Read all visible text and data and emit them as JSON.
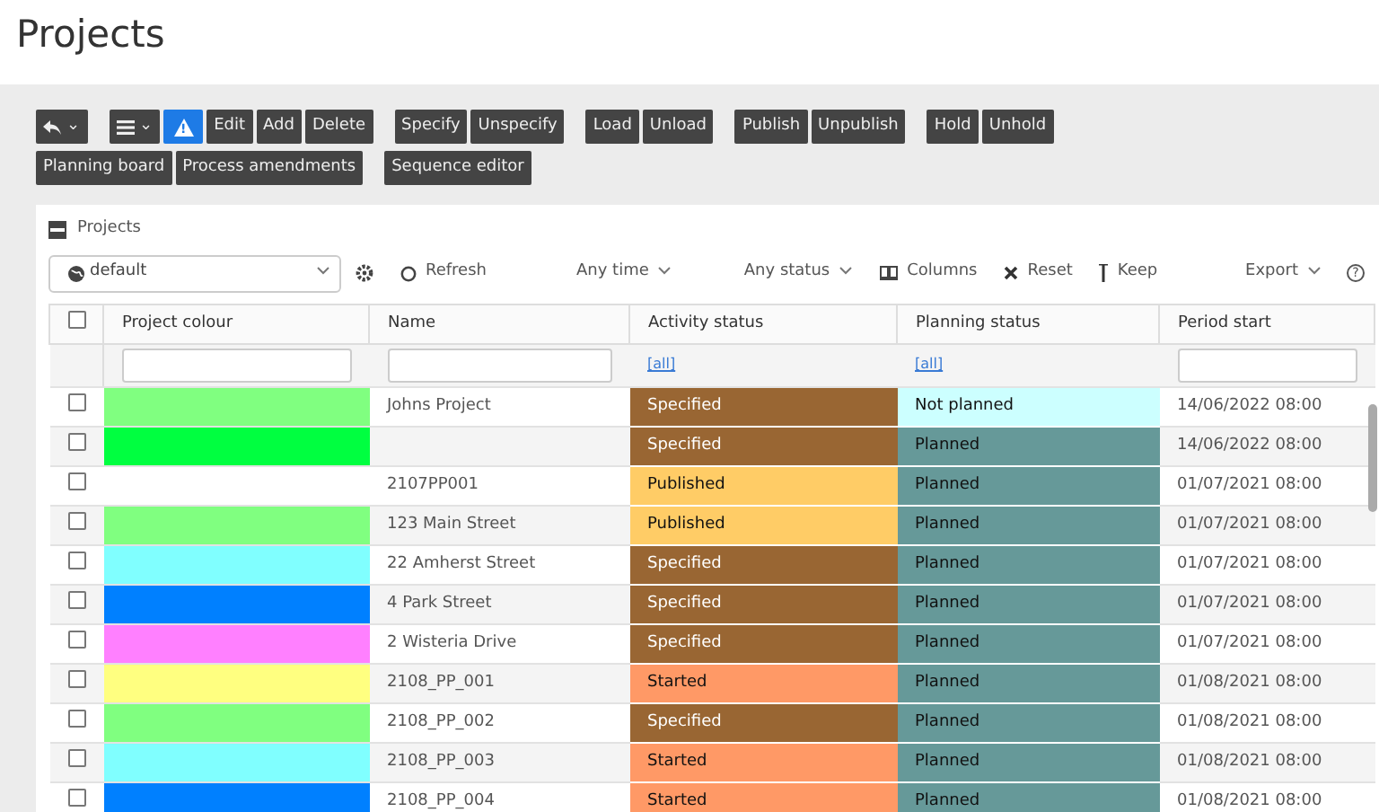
{
  "page_title": "Projects",
  "toolbar": [
    {
      "buttons": [
        {
          "kind": "undo-dropdown",
          "label": "⌄"
        }
      ]
    },
    {
      "buttons": [
        {
          "kind": "menu-dropdown",
          "label": "⌄"
        },
        {
          "kind": "warning",
          "label": "!"
        },
        {
          "kind": "text",
          "label": "Edit"
        },
        {
          "kind": "text",
          "label": "Add"
        },
        {
          "kind": "text",
          "label": "Delete"
        }
      ]
    },
    {
      "buttons": [
        {
          "kind": "text",
          "label": "Specify"
        },
        {
          "kind": "text",
          "label": "Unspecify"
        }
      ]
    },
    {
      "buttons": [
        {
          "kind": "text",
          "label": "Load"
        },
        {
          "kind": "text",
          "label": "Unload"
        }
      ]
    },
    {
      "buttons": [
        {
          "kind": "text",
          "label": "Publish"
        },
        {
          "kind": "text",
          "label": "Unpublish"
        }
      ]
    },
    {
      "buttons": [
        {
          "kind": "text",
          "label": "Hold"
        },
        {
          "kind": "text",
          "label": "Unhold"
        }
      ]
    },
    {
      "buttons": [
        {
          "kind": "text",
          "label": "Planning board"
        },
        {
          "kind": "text",
          "label": "Process amendments"
        }
      ]
    },
    {
      "buttons": [
        {
          "kind": "text",
          "label": "Sequence editor"
        }
      ]
    }
  ],
  "panel": {
    "title": "Projects",
    "view_select": {
      "value": "default"
    },
    "actions": [
      {
        "kind": "refresh",
        "label": "Refresh"
      },
      {
        "kind": "dropdown",
        "label": "Any time"
      },
      {
        "kind": "dropdown",
        "label": "Any status"
      },
      {
        "kind": "columns",
        "label": "Columns"
      },
      {
        "kind": "reset",
        "label": "Reset"
      },
      {
        "kind": "keep",
        "label": "Keep"
      },
      {
        "kind": "dropdown",
        "label": "Export"
      },
      {
        "kind": "help",
        "label": "?"
      }
    ]
  },
  "table": {
    "select_all": {
      "checked": false
    },
    "columns": [
      {
        "label": "Project colour",
        "filter": {
          "kind": "field"
        }
      },
      {
        "label": "Name",
        "filter": {
          "kind": "field"
        }
      },
      {
        "label": "Activity status",
        "filter": {
          "kind": "link",
          "label": "[all]"
        }
      },
      {
        "label": "Planning status",
        "filter": {
          "kind": "link",
          "label": "[all]"
        }
      },
      {
        "label": "Period start",
        "filter": {
          "kind": "field"
        }
      }
    ],
    "rows": [
      {
        "checked": false,
        "color": "#80ff80",
        "name": "Johns Project",
        "activity": {
          "label": "Specified",
          "color": "#996633"
        },
        "planning": {
          "label": "Not planned",
          "color": "#ccffff"
        },
        "period_start": "14/06/2022 08:00"
      },
      {
        "checked": false,
        "color": "#00ff40",
        "name": "",
        "activity": {
          "label": "Specified",
          "color": "#996633"
        },
        "planning": {
          "label": "Planned",
          "color": "#669999"
        },
        "period_start": "14/06/2022 08:00"
      },
      {
        "checked": false,
        "color": "#ffffff",
        "name": "2107PP001",
        "activity": {
          "label": "Published",
          "color": "#ffcc66"
        },
        "planning": {
          "label": "Planned",
          "color": "#669999"
        },
        "period_start": "01/07/2021 08:00"
      },
      {
        "checked": false,
        "color": "#80ff80",
        "name": "123 Main Street",
        "activity": {
          "label": "Published",
          "color": "#ffcc66"
        },
        "planning": {
          "label": "Planned",
          "color": "#669999"
        },
        "period_start": "01/07/2021 08:00"
      },
      {
        "checked": false,
        "color": "#80ffff",
        "name": "22 Amherst Street",
        "activity": {
          "label": "Specified",
          "color": "#996633"
        },
        "planning": {
          "label": "Planned",
          "color": "#669999"
        },
        "period_start": "01/07/2021 08:00"
      },
      {
        "checked": false,
        "color": "#0080ff",
        "name": "4 Park Street",
        "activity": {
          "label": "Specified",
          "color": "#996633"
        },
        "planning": {
          "label": "Planned",
          "color": "#669999"
        },
        "period_start": "01/07/2021 08:00"
      },
      {
        "checked": false,
        "color": "#ff80ff",
        "name": "2 Wisteria Drive",
        "activity": {
          "label": "Specified",
          "color": "#996633"
        },
        "planning": {
          "label": "Planned",
          "color": "#669999"
        },
        "period_start": "01/07/2021 08:00"
      },
      {
        "checked": false,
        "color": "#ffff80",
        "name": "2108_PP_001",
        "activity": {
          "label": "Started",
          "color": "#ff9966"
        },
        "planning": {
          "label": "Planned",
          "color": "#669999"
        },
        "period_start": "01/08/2021 08:00"
      },
      {
        "checked": false,
        "color": "#80ff80",
        "name": "2108_PP_002",
        "activity": {
          "label": "Specified",
          "color": "#996633"
        },
        "planning": {
          "label": "Planned",
          "color": "#669999"
        },
        "period_start": "01/08/2021 08:00"
      },
      {
        "checked": false,
        "color": "#80ffff",
        "name": "2108_PP_003",
        "activity": {
          "label": "Started",
          "color": "#ff9966"
        },
        "planning": {
          "label": "Planned",
          "color": "#669999"
        },
        "period_start": "01/08/2021 08:00"
      },
      {
        "checked": false,
        "color": "#0080ff",
        "name": "2108_PP_004",
        "activity": {
          "label": "Started",
          "color": "#ff9966"
        },
        "planning": {
          "label": "Planned",
          "color": "#669999"
        },
        "period_start": "01/08/2021 08:00"
      }
    ]
  }
}
